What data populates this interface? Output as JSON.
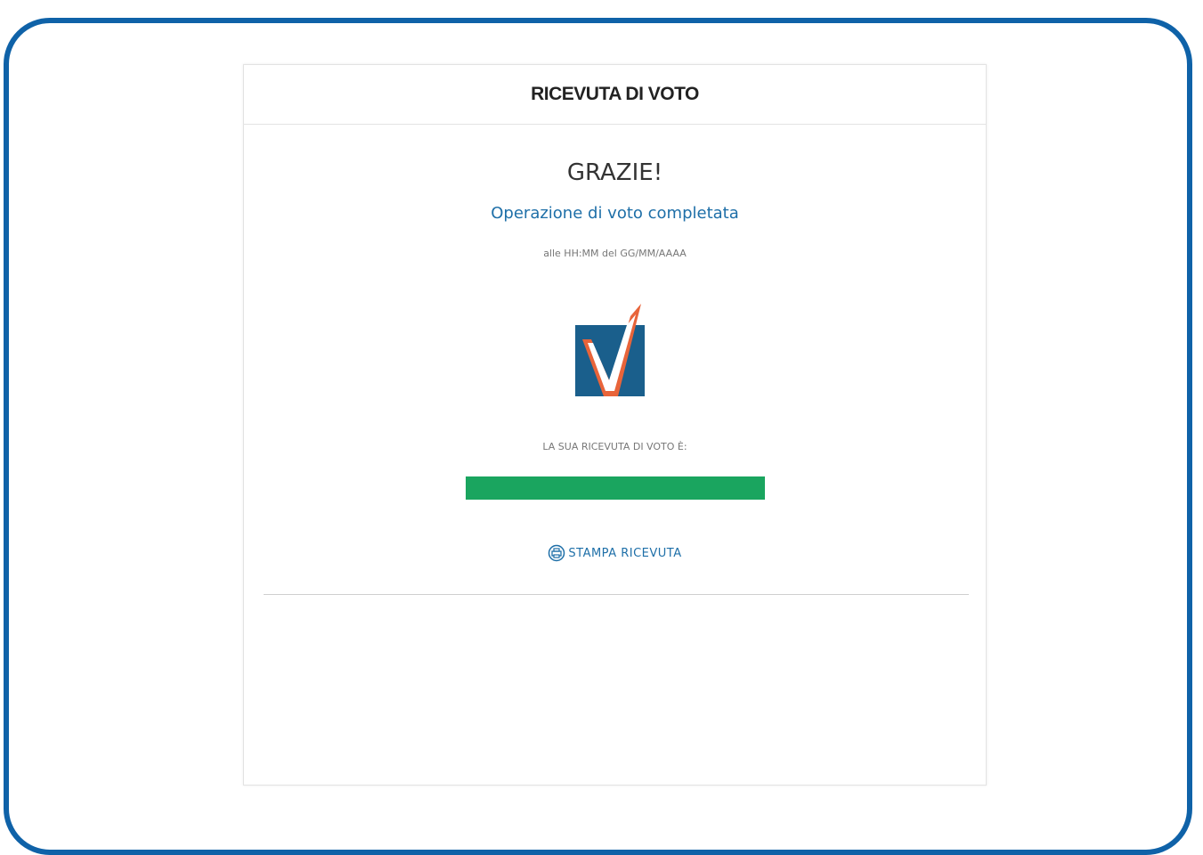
{
  "header": {
    "title": "RICEVUTA DI VOTO"
  },
  "main": {
    "thanks": "GRAZIE!",
    "completed": "Operazione di voto completata",
    "timestamp": "alle HH:MM del GG/MM/AAAA",
    "receipt_label": "LA SUA RICEVUTA DI VOTO È:",
    "receipt_code": "",
    "print_label": "STAMPA RICEVUTA"
  },
  "icons": {
    "logo": "checkmark-logo-icon",
    "print": "printer-icon"
  },
  "colors": {
    "frame": "#0f62a8",
    "accent_blue": "#1e6fa8",
    "receipt_green": "#1aa55f",
    "logo_blue": "#1a5f8c",
    "logo_orange": "#e8643a"
  }
}
